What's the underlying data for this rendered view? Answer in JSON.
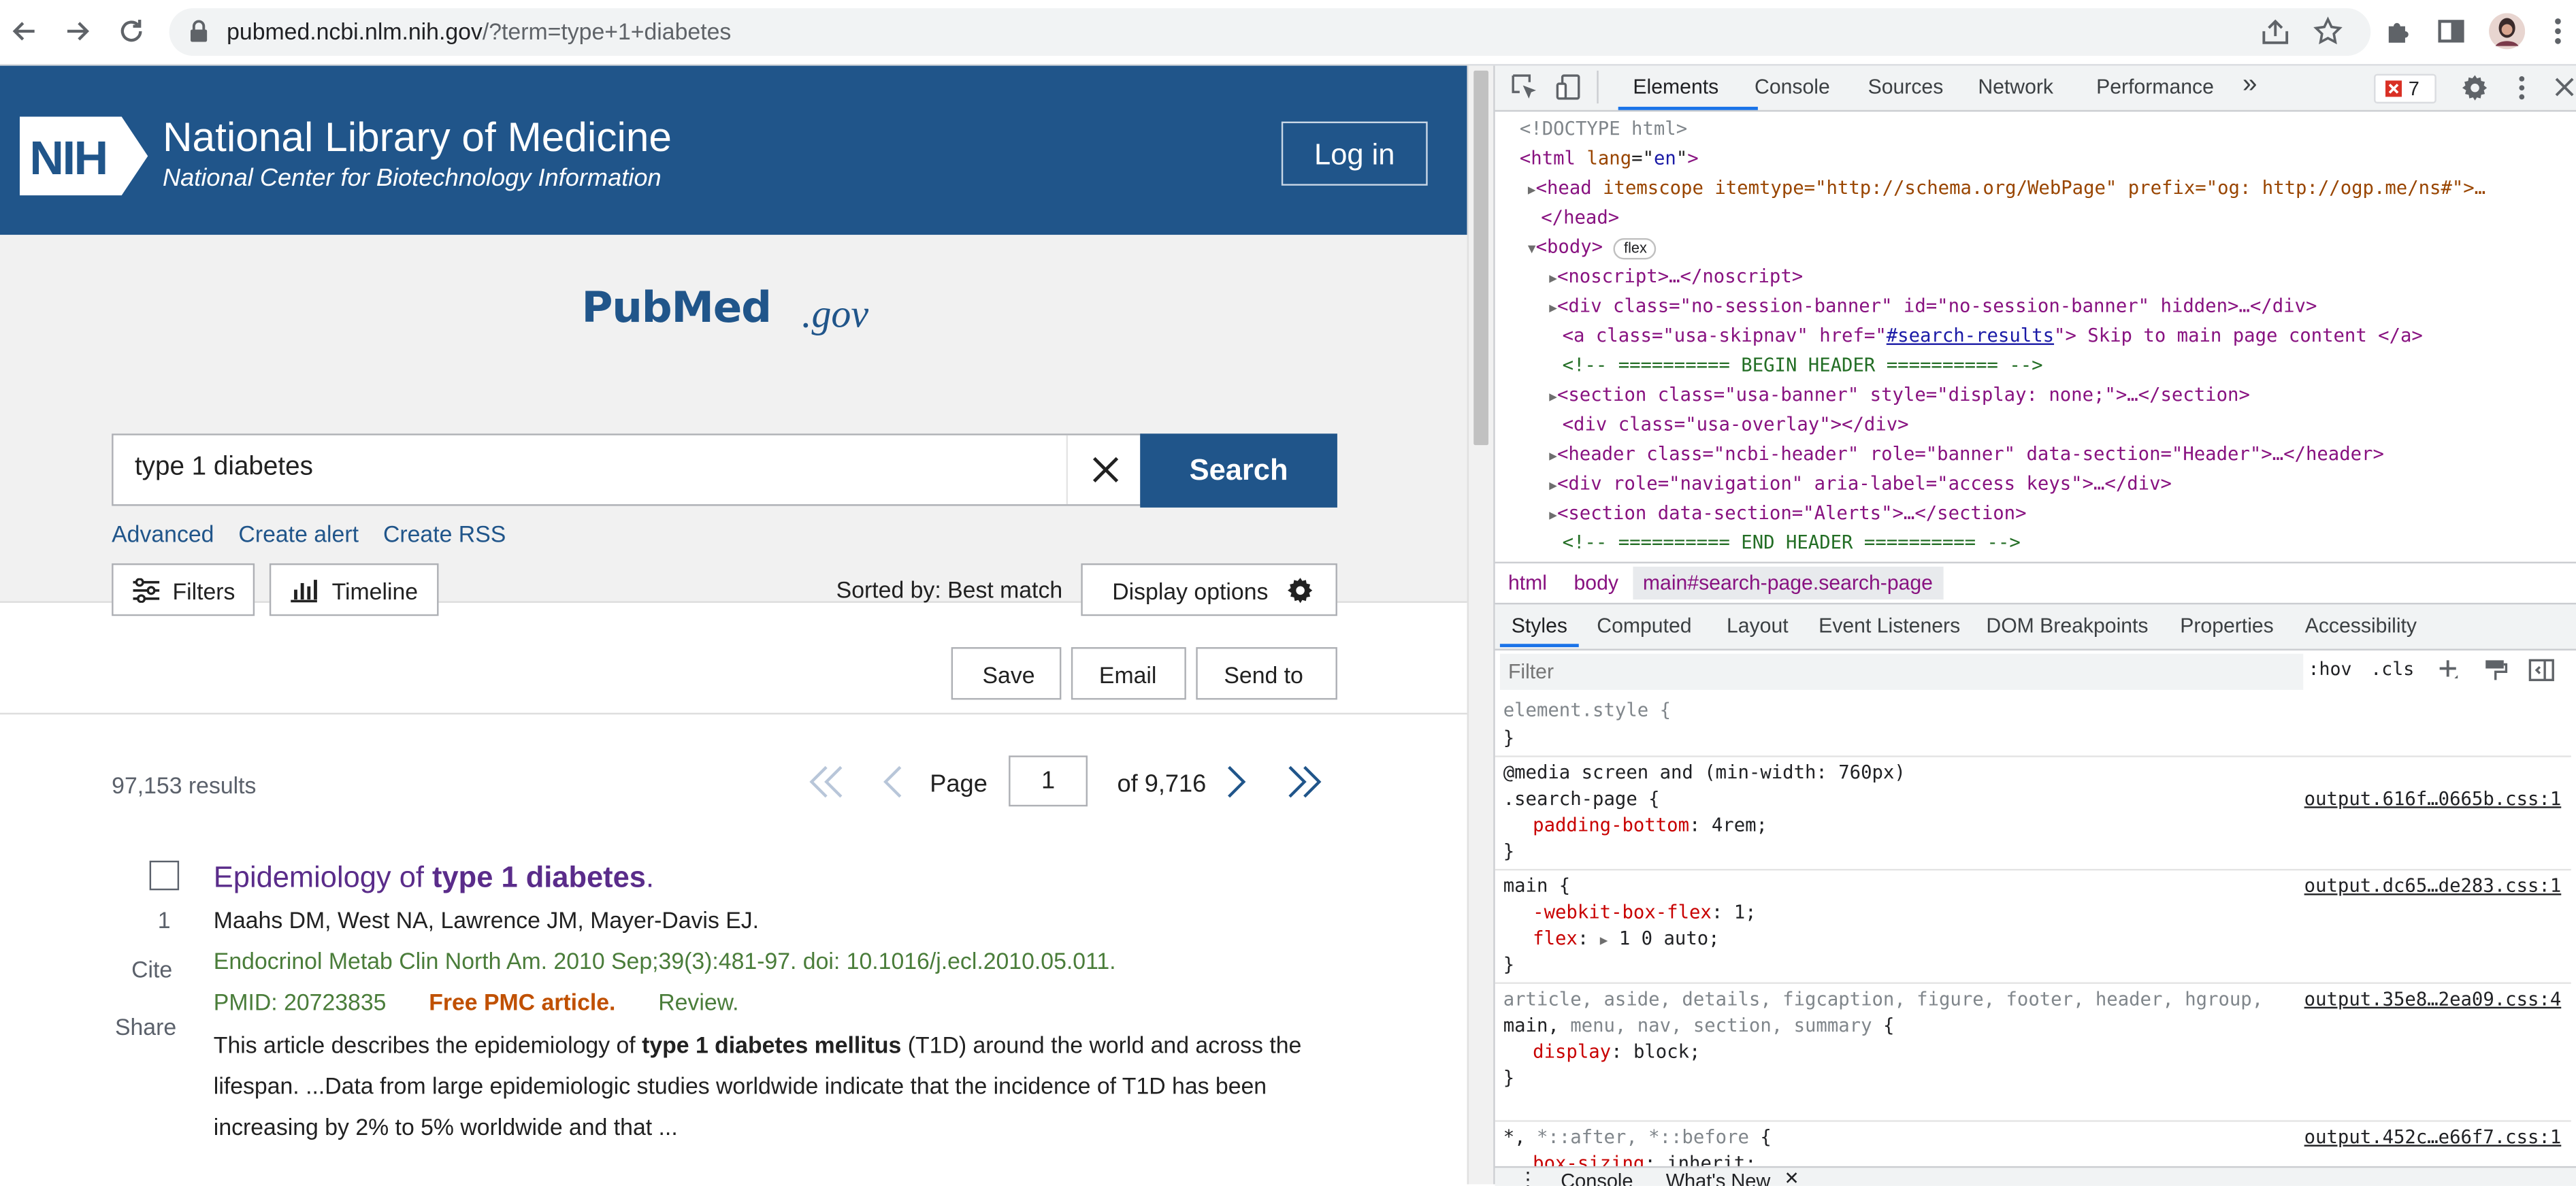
{
  "browser": {
    "url_host": "pubmed.ncbi.nlm.nih.gov",
    "url_path": "/?term=type+1+diabetes"
  },
  "header": {
    "logo_text": "NIH",
    "title": "National Library of Medicine",
    "subtitle": "National Center for Biotechnology Information",
    "login_label": "Log in"
  },
  "search": {
    "logo_pub": "PubMed",
    "logo_gov": ".gov",
    "query": "type 1 diabetes",
    "button_label": "Search",
    "links": [
      "Advanced",
      "Create alert",
      "Create RSS"
    ]
  },
  "toolbar": {
    "filters_label": "Filters",
    "timeline_label": "Timeline",
    "sorted_by": "Sorted by: Best match",
    "display_options_label": "Display options",
    "save_label": "Save",
    "email_label": "Email",
    "send_to_label": "Send to"
  },
  "results": {
    "count_text": "97,153 results",
    "page_label": "Page",
    "current_page": "1",
    "of_pages": "of 9,716"
  },
  "article": {
    "number": "1",
    "cite_label": "Cite",
    "share_label": "Share",
    "title_plain": "Epidemiology of ",
    "title_bold": "type 1 diabetes",
    "title_end": ".",
    "authors": "Maahs DM, West NA, Lawrence JM, Mayer-Davis EJ.",
    "journal": "Endocrinol Metab Clin North Am. 2010 Sep;39(3):481-97. doi: 10.1016/j.ecl.2010.05.011.",
    "pmid": "PMID: 20723835",
    "free_pmc": "Free PMC article.",
    "review": "Review.",
    "snippet_a": "This article describes the epidemiology of ",
    "snippet_bold": "type 1 diabetes mellitus",
    "snippet_b": " (T1D) around the world and across the lifespan. ...Data from large epidemiologic studies worldwide indicate that the incidence of T1D has been increasing by 2% to 5% worldwide and that ..."
  },
  "devtools": {
    "tabs": [
      "Elements",
      "Console",
      "Sources",
      "Network",
      "Performance"
    ],
    "more_tabs": "»",
    "error_count": "7",
    "dom": {
      "doctype": "<!DOCTYPE html>",
      "html_open": "html",
      "html_attr": "lang",
      "html_val": "en",
      "head_attrs": "itemscope itemtype=\"http://schema.org/WebPage\" prefix=\"og: http://ogp.me/ns#\">…",
      "head_close": "</head>",
      "body_tag": "<body>",
      "body_badge": "flex",
      "noscript": "<noscript>…</noscript>",
      "div1": "<div class=\"no-session-banner\" id=\"no-session-banner\" hidden>…</div>",
      "a_pre": "<a class=\"usa-skipnav\" href=\"",
      "a_href": "#search-results",
      "a_post": "\"> Skip to main page content </a>",
      "comment1": "<!-- ========== BEGIN HEADER ========== -->",
      "section1": "<section class=\"usa-banner\" style=\"display: none;\">…</section>",
      "div2": "<div class=\"usa-overlay\"></div>",
      "header": "<header class=\"ncbi-header\" role=\"banner\" data-section=\"Header\">…</header>",
      "div3": "<div role=\"navigation\" aria-label=\"access keys\">…</div>",
      "section2": "<section data-section=\"Alerts\">…</section>",
      "comment2": "<!-- ========== END HEADER ========== -->"
    },
    "breadcrumbs": [
      "html",
      "body",
      "main#search-page.search-page"
    ],
    "style_tabs": [
      "Styles",
      "Computed",
      "Layout",
      "Event Listeners",
      "DOM Breakpoints",
      "Properties",
      "Accessibility"
    ],
    "filter_placeholder": "Filter",
    "hov": ":hov",
    "cls": ".cls",
    "styles": {
      "element_style": "element.style {",
      "close": "}",
      "media": "@media screen and (min-width: 760px)",
      "rule1_sel": ".search-page {",
      "rule1_src": "output.616f…0665b.css:1",
      "rule1_prop": "padding-bottom",
      "rule1_val": "4rem;",
      "rule2_sel": "main {",
      "rule2_src": "output.dc65…de283.css:1",
      "rule2_prop1": "-webkit-box-flex",
      "rule2_val1": "1;",
      "rule2_prop2": "flex",
      "rule2_val2": "1 0 auto;",
      "rule3_sel1": "article, aside, details, figcaption, figure, footer, header, hgroup,",
      "rule3_sel2a": "main, ",
      "rule3_sel2b": "menu, nav, section, summary",
      "rule3_sel2c": " {",
      "rule3_src": "output.35e8…2ea09.css:4",
      "rule3_prop": "display",
      "rule3_val": "block;",
      "rule4_sel_a": "*, ",
      "rule4_sel_b": "*::after, *::before",
      "rule4_sel_c": " {",
      "rule4_src": "output.452c…e66f7.css:1",
      "rule4_prop": "box-sizing",
      "rule4_val": "inherit;"
    },
    "drawer_tabs": [
      "Console",
      "What's New"
    ]
  }
}
